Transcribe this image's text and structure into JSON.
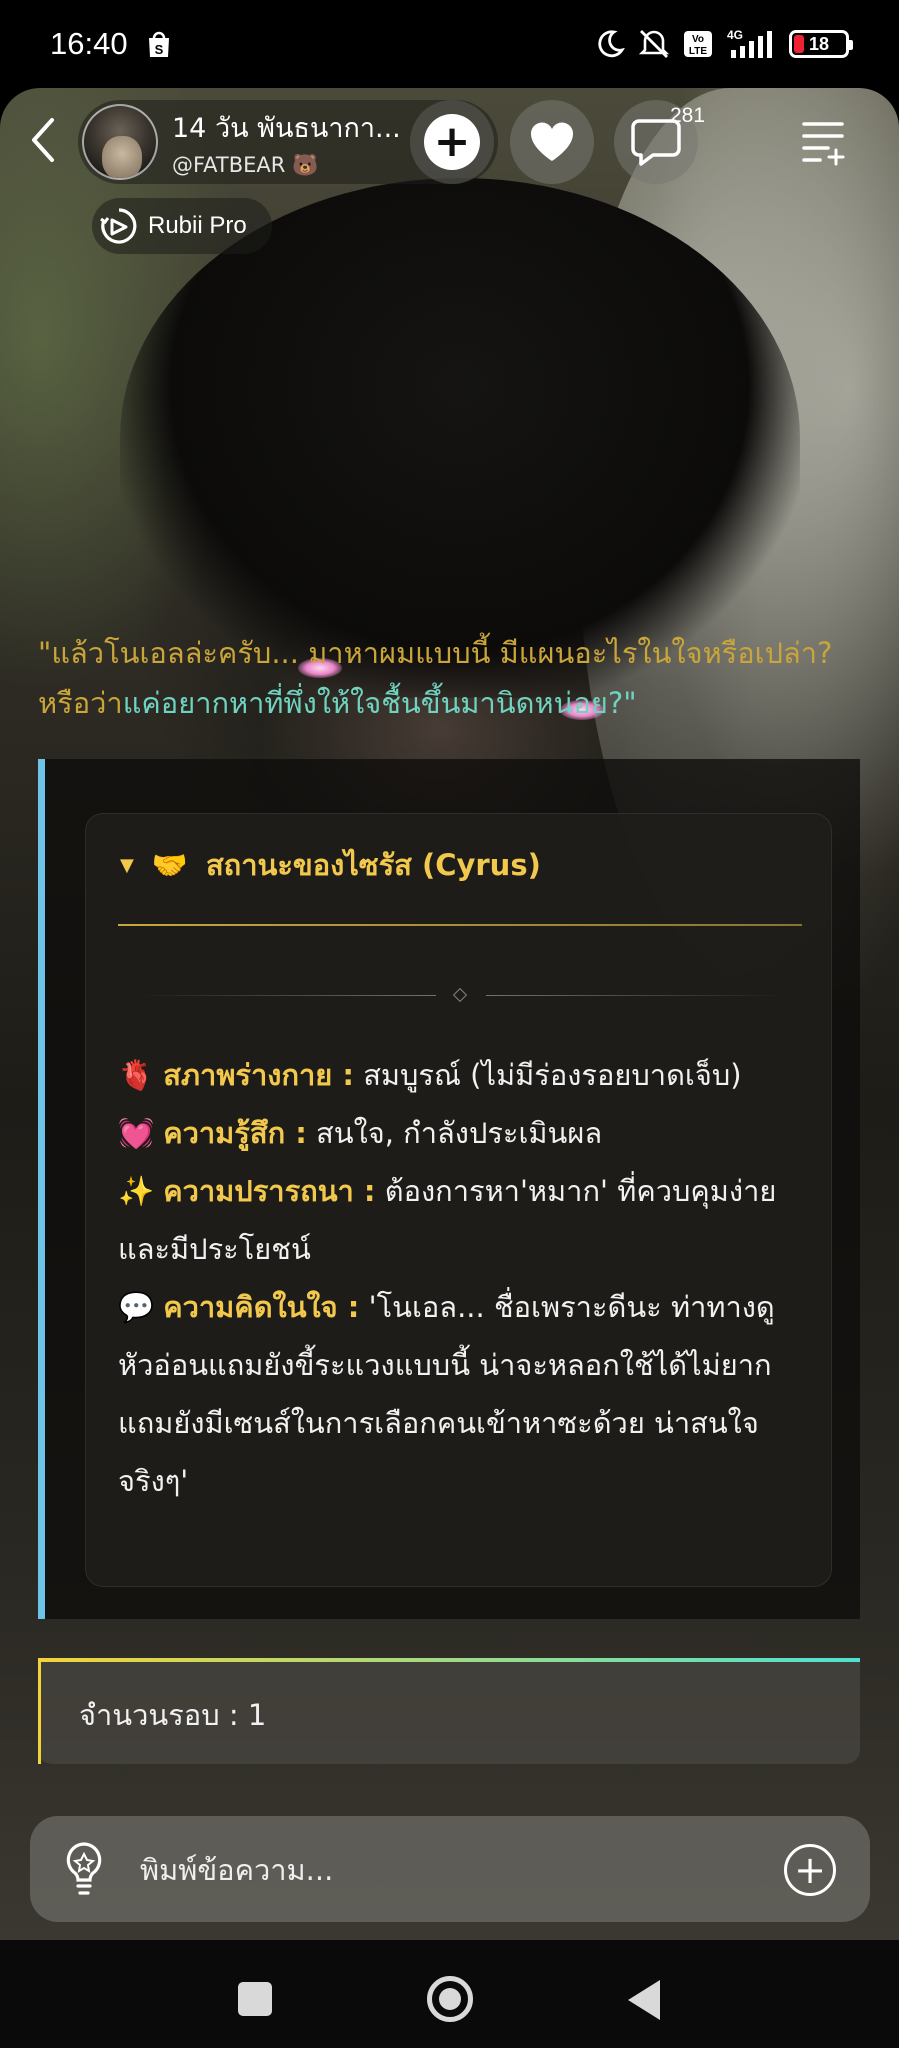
{
  "status_bar": {
    "time": "16:40",
    "battery_level": "18",
    "network": "4G",
    "icons": [
      "shopee-bag-icon",
      "moon-icon",
      "mute-icon",
      "volte-icon",
      "signal-icon",
      "battery-icon"
    ]
  },
  "header": {
    "title": "14 วัน พันธนากา...",
    "username": "@FATBEAR 🐻",
    "comment_count": "281",
    "plus_label": "+",
    "badge_label": "Rubii Pro"
  },
  "quote": {
    "part1": "\"แล้วโนเอลล่ะครับ... มาหาผมแบบนี้ มีแผนอะไรในใจหรือเปล่า? หรือว่า",
    "part2": "แค่อยากหาที่พึ่งให้ใจชื้นขึ้นมานิดหน่อย?\""
  },
  "status_card": {
    "caret": "▼",
    "heading_emoji": "🤝",
    "heading": "สถานะของไซรัส (Cyrus)",
    "rows": [
      {
        "emoji": "🫀",
        "key": "สภาพร่างกาย :",
        "value": " สมบูรณ์ (ไม่มีร่องรอยบาดเจ็บ)"
      },
      {
        "emoji": "💓",
        "key": "ความรู้สึก :",
        "value": " สนใจ, กำลังประเมินผล"
      },
      {
        "emoji": "✨",
        "key": "ความปรารถนา :",
        "value": " ต้องการหา'หมาก' ที่ควบคุมง่ายและมีประโยชน์"
      },
      {
        "emoji": "💬",
        "key": "ความคิดในใจ :",
        "value": " 'โนเอล... ชื่อเพราะดีนะ ท่าทางดูหัวอ่อนแถมยังขี้ระแวงแบบนี้ น่าจะหลอกใช้ได้ไม่ยาก แถมยังมีเซนส์ในการเลือกคนเข้าหาซะด้วย น่าสนใจจริงๆ'"
      }
    ]
  },
  "rounds": {
    "text": "จำนวนรอบ : 1"
  },
  "composer": {
    "placeholder": "พิมพ์ข้อความ...",
    "add_label": "+"
  },
  "colors": {
    "accent_gold": "#f2c94c",
    "accent_teal": "#6fd3c0",
    "card_border": "#6ec4e8"
  }
}
